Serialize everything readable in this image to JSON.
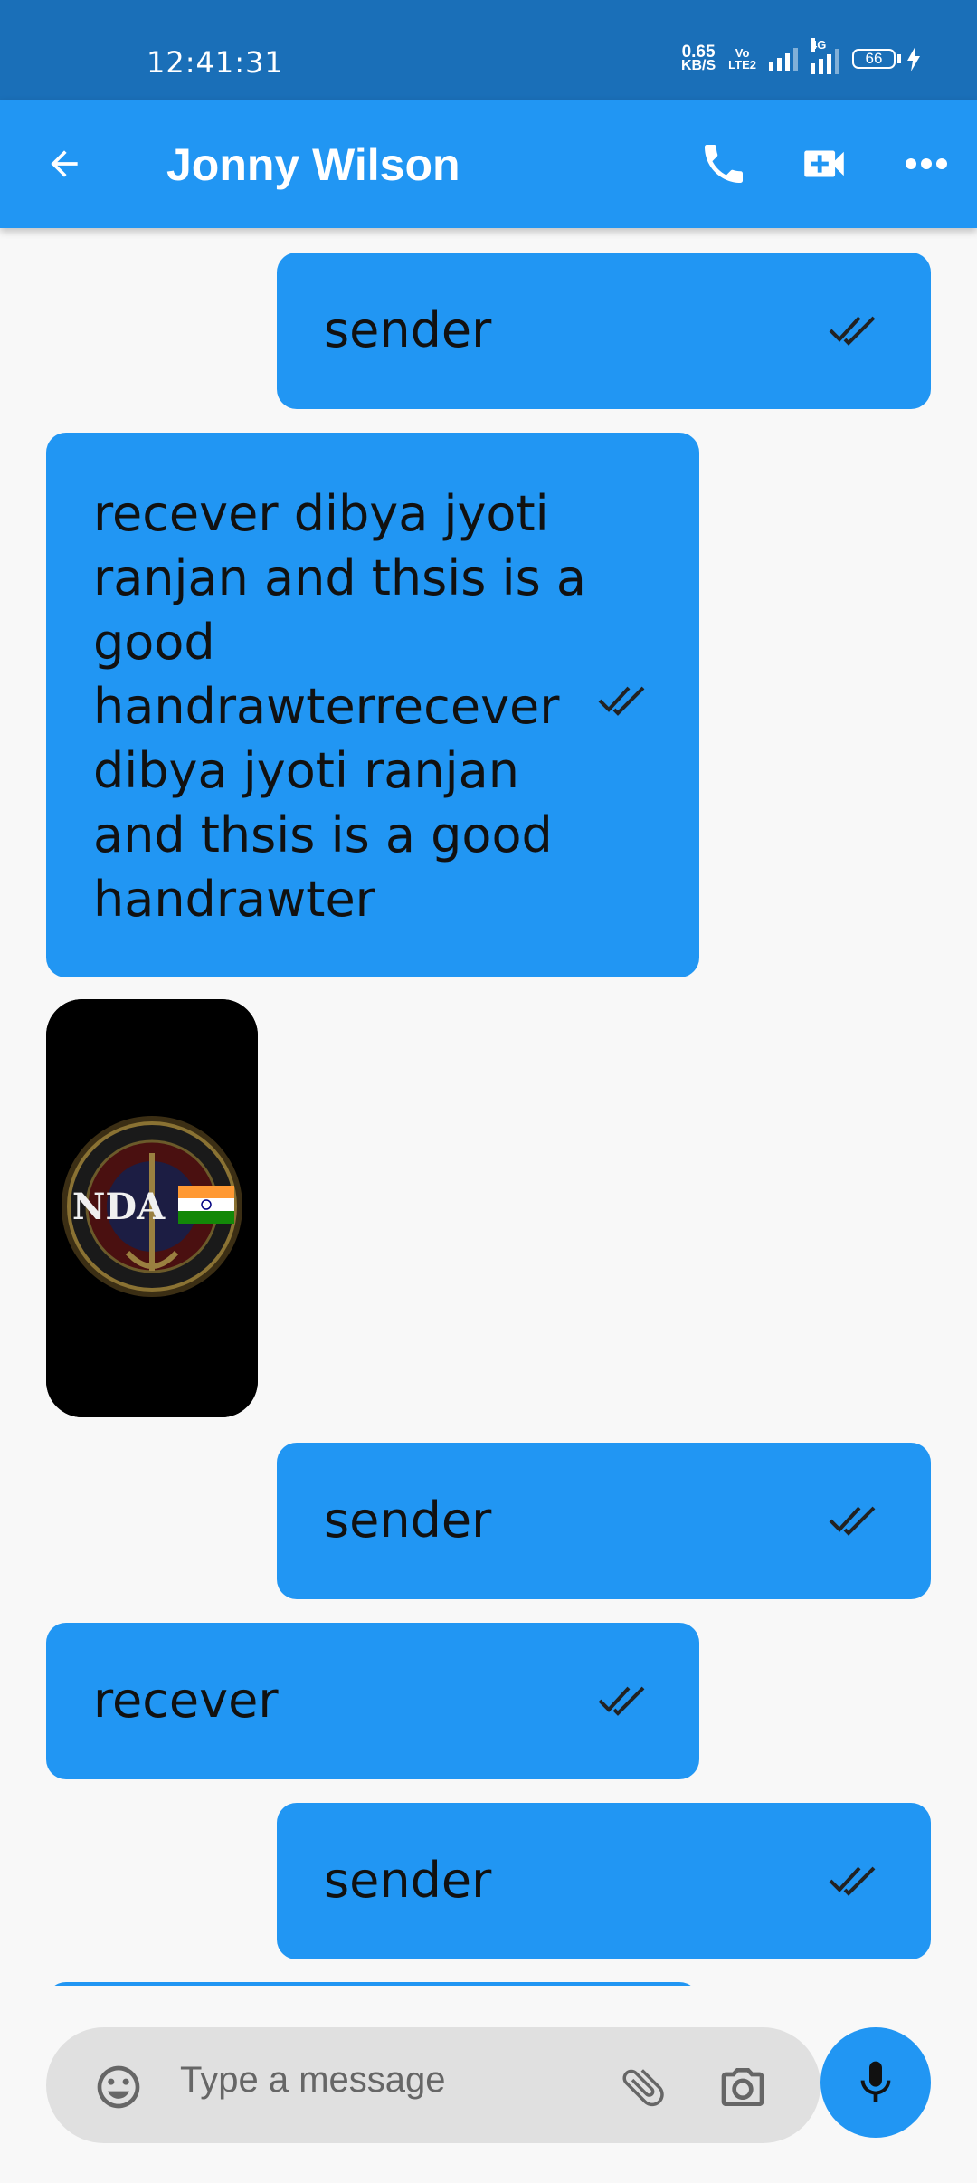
{
  "status_bar": {
    "time": "12:41:31",
    "net_speed_value": "0.65",
    "net_speed_unit": "KB/S",
    "volte_top": "Vo",
    "volte_bottom": "LTE2",
    "network_tag": "4G",
    "battery_level": "66",
    "icons": [
      "signal-icon",
      "signal-4g-icon",
      "battery-icon",
      "charging-icon"
    ]
  },
  "header": {
    "title": "Jonny Wilson",
    "icons": [
      "back-arrow-icon",
      "phone-icon",
      "video-call-icon",
      "more-icon"
    ]
  },
  "messages": [
    {
      "side": "right",
      "type": "text",
      "text": "sender",
      "status": "double-check-icon"
    },
    {
      "side": "left",
      "type": "text",
      "lines": [
        "recever dibya jyoti",
        "ranjan and thsis is a",
        "good",
        "handrawterrecever",
        "dibya jyoti ranjan",
        "and thsis is a good",
        "handrawter"
      ],
      "status": "double-check-icon"
    },
    {
      "side": "left",
      "type": "image",
      "image_text": "NDA"
    },
    {
      "side": "right",
      "type": "text",
      "text": "sender",
      "status": "double-check-icon"
    },
    {
      "side": "left",
      "type": "text",
      "text": "recever",
      "status": "double-check-icon"
    },
    {
      "side": "right",
      "type": "text",
      "text": "sender",
      "status": "double-check-icon"
    }
  ],
  "composer": {
    "placeholder": "Type a message",
    "icons": [
      "emoji-icon",
      "attach-icon",
      "camera-icon",
      "mic-icon"
    ]
  },
  "colors": {
    "status_bar": "#1a6fb8",
    "app_bar": "#2196f3",
    "bubble": "#2196f3",
    "background": "#f8f8f8",
    "input_background": "#e0e0e0"
  }
}
